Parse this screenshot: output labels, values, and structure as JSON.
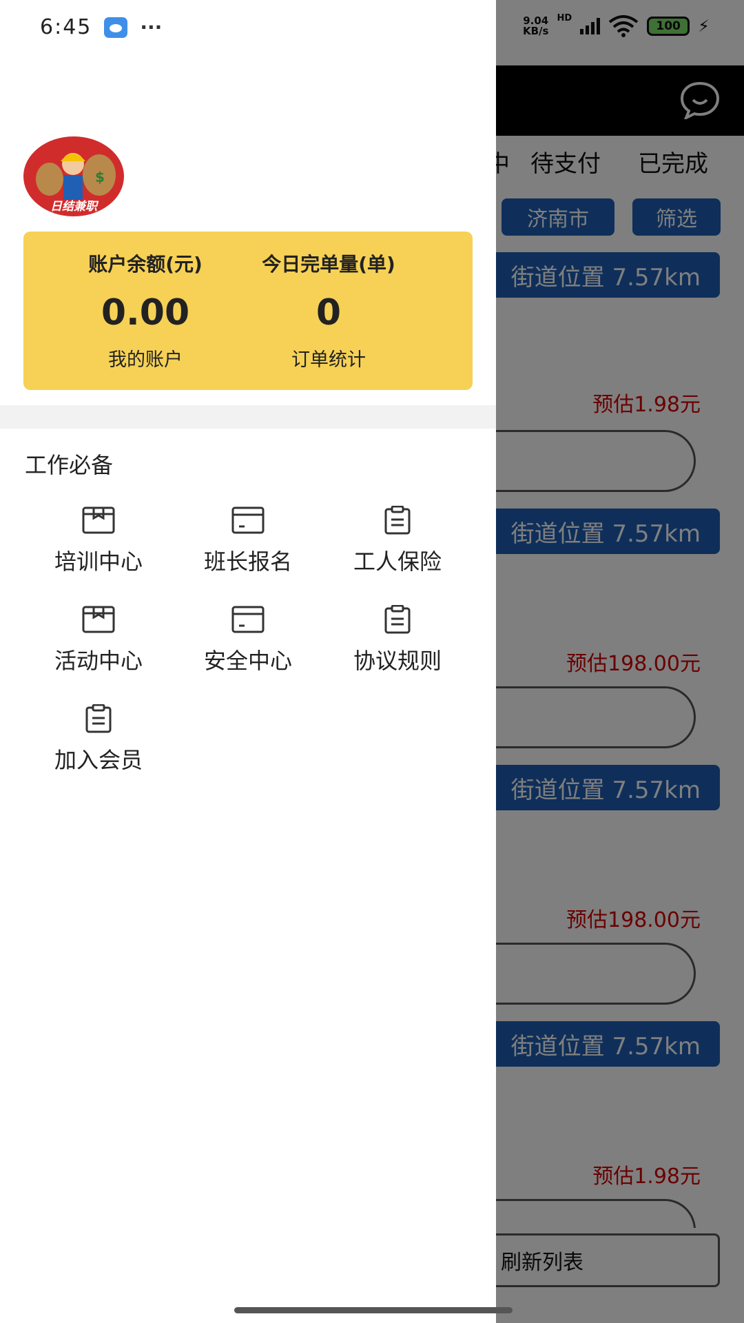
{
  "status_bar": {
    "time": "6:45",
    "more_dots": "···",
    "net_speed_value": "9.04",
    "net_speed_unit": "KB/s",
    "hd_label": "HD",
    "battery": "100"
  },
  "background": {
    "tabs": [
      "中",
      "待支付",
      "已完成"
    ],
    "filters": [
      "济南市",
      "筛选"
    ],
    "cards": [
      {
        "location": "街道位置 7.57km",
        "price": "预估1.98元"
      },
      {
        "location": "街道位置 7.57km",
        "price": "预估198.00元"
      },
      {
        "location": "街道位置 7.57km",
        "price": "预估198.00元"
      },
      {
        "location": "街道位置 7.57km",
        "price": "预估1.98元"
      }
    ],
    "refresh_label": "刷新列表"
  },
  "drawer": {
    "avatar_text": "日结兼职",
    "stats": [
      {
        "label": "账户余额(元)",
        "value": "0.00",
        "link": "我的账户"
      },
      {
        "label": "今日完单量(单)",
        "value": "0",
        "link": "订单统计"
      }
    ],
    "section_title": "工作必备",
    "tools": [
      {
        "label": "培训中心",
        "icon": "box-icon"
      },
      {
        "label": "班长报名",
        "icon": "card-icon"
      },
      {
        "label": "工人保险",
        "icon": "clipboard-icon"
      },
      {
        "label": "活动中心",
        "icon": "box-icon"
      },
      {
        "label": "安全中心",
        "icon": "card-icon"
      },
      {
        "label": "协议规则",
        "icon": "clipboard-icon"
      },
      {
        "label": "加入会员",
        "icon": "clipboard-icon"
      }
    ]
  }
}
